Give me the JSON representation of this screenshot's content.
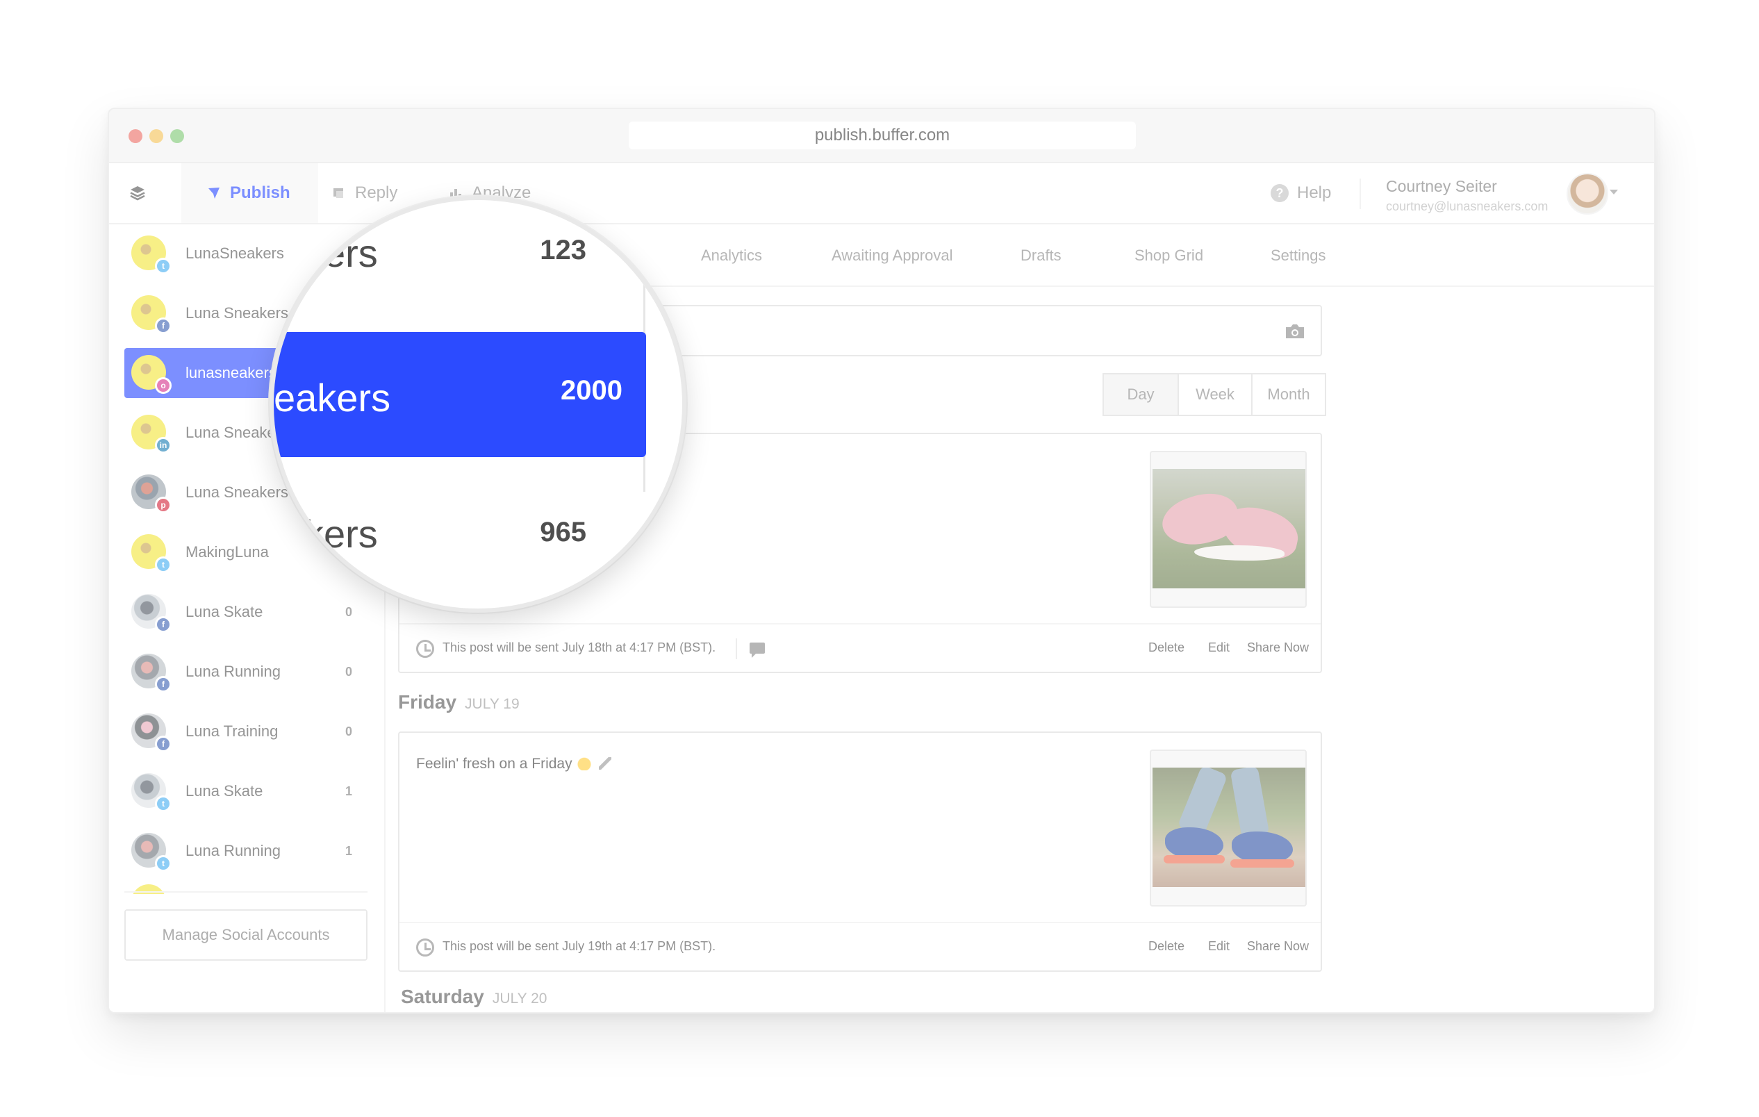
{
  "browser": {
    "url": "publish.buffer.com"
  },
  "topnav": {
    "tabs": [
      {
        "label": "Publish"
      },
      {
        "label": "Reply"
      },
      {
        "label": "Analyze"
      }
    ],
    "help_label": "Help",
    "user_name": "Courtney Seiter",
    "user_email": "courtney@lunasneakers.com"
  },
  "sidebar": {
    "accounts": [
      {
        "name": "LunaSneakers",
        "network": "twitter",
        "count": ""
      },
      {
        "name": "Luna Sneakers",
        "network": "facebook",
        "count": ""
      },
      {
        "name": "lunasneakers",
        "network": "instagram",
        "count": ""
      },
      {
        "name": "Luna Sneakers",
        "network": "linkedin",
        "count": ""
      },
      {
        "name": "Luna Sneakers",
        "network": "pinterest",
        "count": ""
      },
      {
        "name": "MakingLuna",
        "network": "twitter",
        "count": ""
      },
      {
        "name": "Luna Skate",
        "network": "facebook",
        "count": "0"
      },
      {
        "name": "Luna Running",
        "network": "facebook",
        "count": "0"
      },
      {
        "name": "Luna Training",
        "network": "facebook",
        "count": "0"
      },
      {
        "name": "Luna Skate",
        "network": "twitter",
        "count": "1"
      },
      {
        "name": "Luna Running",
        "network": "twitter",
        "count": "1"
      }
    ],
    "manage_label": "Manage Social Accounts"
  },
  "subnav": {
    "tabs": [
      "Analytics",
      "Awaiting Approval",
      "Drafts",
      "Shop Grid",
      "Settings"
    ]
  },
  "view_toggle": {
    "options": [
      "Day",
      "Week",
      "Month"
    ],
    "selected": "Day"
  },
  "posts": [
    {
      "text": "",
      "footer": "This post will be sent July 18th at 4:17 PM (BST).",
      "actions": [
        "Delete",
        "Edit",
        "Share Now"
      ]
    },
    {
      "text": "Feelin' fresh on a Friday",
      "footer": "This post will be sent July 19th at 4:17 PM (BST).",
      "actions": [
        "Delete",
        "Edit",
        "Share Now"
      ]
    }
  ],
  "days": [
    {
      "name": "Friday",
      "date": "JULY 19"
    },
    {
      "name": "Saturday",
      "date": "JULY 20"
    }
  ],
  "magnifier": {
    "rows": [
      {
        "label": "kers",
        "count": "123"
      },
      {
        "label": "eakers",
        "count": "2000"
      },
      {
        "label": "kers",
        "count": "965"
      }
    ]
  },
  "colors": {
    "accent": "#2c4bff",
    "twitter": "#48aef1",
    "facebook": "#3e63b4",
    "instagram": "#d6348f",
    "linkedin": "#1c7fb5",
    "pinterest": "#d4263b"
  }
}
